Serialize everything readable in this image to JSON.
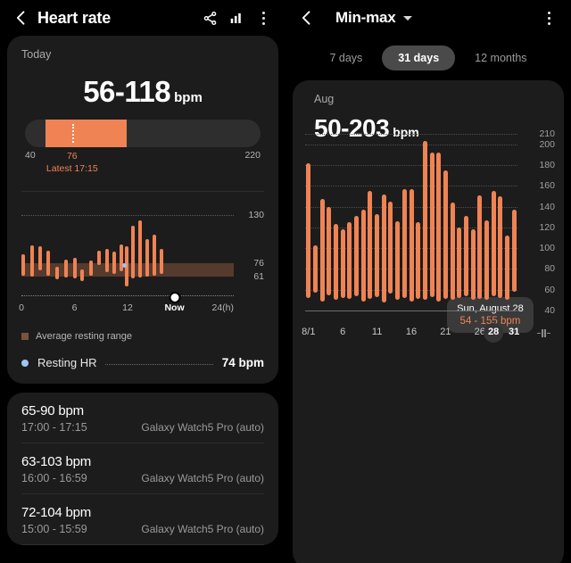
{
  "left": {
    "header": {
      "back_icon": "chevron-left-icon",
      "title": "Heart rate",
      "share_icon": "share-icon",
      "stats_icon": "bar-chart-icon",
      "more_icon": "overflow-menu-icon"
    },
    "period_label": "Today",
    "summary": {
      "value": "56-118",
      "unit": "bpm"
    },
    "range_bar": {
      "min_label": "40",
      "max_label": "220",
      "axis_min": 40,
      "axis_max": 220,
      "fill_start": 56,
      "fill_end": 118,
      "marker_value": 76,
      "marker_label": "76",
      "latest_label": "Latest 17:15"
    },
    "daily_chart": {
      "gridlines": [
        {
          "value": 130,
          "label": "130"
        }
      ],
      "resting_band": {
        "low": 61,
        "high": 76,
        "low_label": "61",
        "high_label": "76"
      },
      "y_min": 40,
      "y_max": 140,
      "x_ticks": [
        "0",
        "6",
        "12",
        "24(h)"
      ],
      "now_label": "Now",
      "now_hour": 17.3,
      "resting_dot": {
        "hour": 11.6,
        "value": 74
      },
      "bars": [
        {
          "hour": 0.2,
          "low": 62,
          "high": 86
        },
        {
          "hour": 1.2,
          "low": 61,
          "high": 96
        },
        {
          "hour": 2.1,
          "low": 68,
          "high": 95
        },
        {
          "hour": 3.0,
          "low": 62,
          "high": 90
        },
        {
          "hour": 4.0,
          "low": 58,
          "high": 72
        },
        {
          "hour": 5.0,
          "low": 60,
          "high": 80
        },
        {
          "hour": 6.0,
          "low": 59,
          "high": 82
        },
        {
          "hour": 6.9,
          "low": 56,
          "high": 69
        },
        {
          "hour": 7.9,
          "low": 62,
          "high": 79
        },
        {
          "hour": 8.8,
          "low": 74,
          "high": 90
        },
        {
          "hour": 9.7,
          "low": 66,
          "high": 92
        },
        {
          "hour": 10.5,
          "low": 64,
          "high": 89
        },
        {
          "hour": 11.3,
          "low": 67,
          "high": 97
        },
        {
          "hour": 11.9,
          "low": 50,
          "high": 95
        },
        {
          "hour": 12.6,
          "low": 59,
          "high": 118
        },
        {
          "hour": 13.4,
          "low": 60,
          "high": 124
        },
        {
          "hour": 14.2,
          "low": 61,
          "high": 103
        },
        {
          "hour": 15.0,
          "low": 62,
          "high": 108
        },
        {
          "hour": 15.8,
          "low": 64,
          "high": 92
        }
      ],
      "legend": {
        "swatch_color": "#7a5240",
        "label": "Average resting range"
      }
    },
    "resting_hr": {
      "label": "Resting HR",
      "value": "74 bpm",
      "dot_color": "#9ec6ef"
    },
    "records": [
      {
        "value": "65-90 bpm",
        "time": "17:00 - 17:15",
        "source": "Galaxy Watch5 Pro (auto)"
      },
      {
        "value": "63-103 bpm",
        "time": "16:00 - 16:59",
        "source": "Galaxy Watch5 Pro (auto)"
      },
      {
        "value": "72-104 bpm",
        "time": "15:00 - 15:59",
        "source": "Galaxy Watch5 Pro (auto)"
      }
    ]
  },
  "right": {
    "header": {
      "back_icon": "chevron-left-icon",
      "title": "Min-max",
      "dropdown_icon": "chevron-down-icon",
      "more_icon": "overflow-menu-icon"
    },
    "tabs": [
      {
        "label": "7 days",
        "active": false
      },
      {
        "label": "31 days",
        "active": true
      },
      {
        "label": "12 months",
        "active": false
      }
    ],
    "month_label": "Aug",
    "summary": {
      "value": "50-203",
      "unit": "bpm"
    },
    "tooltip": {
      "date": "Sun, August 28",
      "value": "54 - 155 bpm",
      "day": 28
    },
    "resize_icon": "resize-handle-icon",
    "accent_color": "#ef8354"
  },
  "chart_data": [
    {
      "type": "bar",
      "title": "Aug",
      "subtitle": "50-203 bpm",
      "xlabel": "",
      "ylabel": "bpm",
      "ylim": [
        40,
        210
      ],
      "grid": true,
      "yticks": [
        40,
        60,
        80,
        100,
        120,
        140,
        160,
        180,
        200,
        210
      ],
      "ytick_labels": [
        "40",
        "60",
        "80",
        "100",
        "120",
        "140",
        "160",
        "180",
        "200",
        "210"
      ],
      "xticks": [
        1,
        6,
        11,
        16,
        21,
        26,
        28,
        31
      ],
      "xtick_labels": [
        "8/1",
        "6",
        "11",
        "16",
        "21",
        "26",
        "28",
        "31"
      ],
      "categories": [
        1,
        2,
        3,
        4,
        5,
        6,
        7,
        8,
        9,
        10,
        11,
        12,
        13,
        14,
        15,
        16,
        17,
        18,
        19,
        20,
        21,
        22,
        23,
        24,
        25,
        26,
        27,
        28,
        29,
        30,
        31
      ],
      "series": [
        {
          "name": "Min",
          "values": [
            52,
            57,
            49,
            55,
            50,
            52,
            51,
            54,
            49,
            51,
            53,
            48,
            56,
            50,
            52,
            49,
            51,
            50,
            53,
            49,
            51,
            50,
            52,
            54,
            50,
            51,
            50,
            54,
            52,
            50,
            58
          ]
        },
        {
          "name": "Max",
          "values": [
            182,
            103,
            147,
            140,
            123,
            118,
            125,
            131,
            137,
            155,
            133,
            152,
            145,
            126,
            157,
            157,
            125,
            203,
            192,
            192,
            175,
            144,
            120,
            131,
            118,
            151,
            127,
            155,
            150,
            112,
            137
          ]
        }
      ],
      "annotations": [
        {
          "x": 28,
          "label": "Sun, August 28",
          "value": "54 - 155 bpm"
        }
      ]
    },
    {
      "type": "bar",
      "title": "Today",
      "subtitle": "56-118 bpm",
      "xlabel": "(h)",
      "ylabel": "bpm",
      "ylim": [
        40,
        140
      ],
      "yticks": [
        130
      ],
      "ytick_labels": [
        "130"
      ],
      "xticks": [
        0,
        6,
        12,
        24
      ],
      "xtick_labels": [
        "0",
        "6",
        "12",
        "24(h)"
      ],
      "categories": [
        0.2,
        1.2,
        2.1,
        3.0,
        4.0,
        5.0,
        6.0,
        6.9,
        7.9,
        8.8,
        9.7,
        10.5,
        11.3,
        11.9,
        12.6,
        13.4,
        14.2,
        15.0,
        15.8
      ],
      "series": [
        {
          "name": "Min",
          "values": [
            62,
            61,
            68,
            62,
            58,
            60,
            59,
            56,
            62,
            74,
            66,
            64,
            67,
            50,
            59,
            60,
            61,
            62,
            64
          ]
        },
        {
          "name": "Max",
          "values": [
            86,
            96,
            95,
            90,
            72,
            80,
            82,
            69,
            79,
            90,
            92,
            89,
            97,
            95,
            118,
            124,
            103,
            108,
            92
          ]
        }
      ],
      "bands": [
        {
          "name": "Average resting range",
          "low": 61,
          "high": 76,
          "color": "#7a5240"
        }
      ],
      "points": [
        {
          "name": "Resting HR",
          "x": 11.6,
          "y": 74,
          "color": "#9ec6ef"
        }
      ]
    }
  ]
}
